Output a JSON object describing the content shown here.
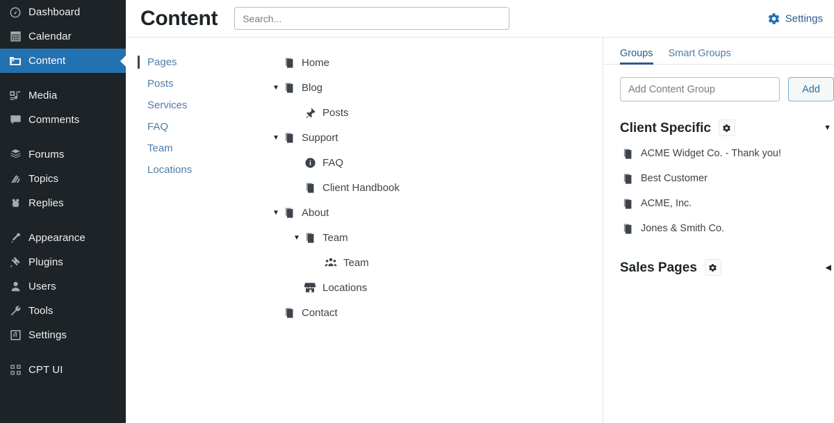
{
  "sidebar": {
    "items": [
      {
        "label": "Dashboard",
        "icon": "dashboard-icon",
        "active": false,
        "gap_after": false
      },
      {
        "label": "Calendar",
        "icon": "calendar-icon",
        "active": false,
        "gap_after": false
      },
      {
        "label": "Content",
        "icon": "folder-icon",
        "active": true,
        "gap_after": true
      },
      {
        "label": "Media",
        "icon": "media-icon",
        "active": false,
        "gap_after": false
      },
      {
        "label": "Comments",
        "icon": "comments-icon",
        "active": false,
        "gap_after": true
      },
      {
        "label": "Forums",
        "icon": "forums-icon",
        "active": false,
        "gap_after": false
      },
      {
        "label": "Topics",
        "icon": "topics-icon",
        "active": false,
        "gap_after": false
      },
      {
        "label": "Replies",
        "icon": "replies-icon",
        "active": false,
        "gap_after": true
      },
      {
        "label": "Appearance",
        "icon": "appearance-icon",
        "active": false,
        "gap_after": false
      },
      {
        "label": "Plugins",
        "icon": "plugins-icon",
        "active": false,
        "gap_after": false
      },
      {
        "label": "Users",
        "icon": "users-icon",
        "active": false,
        "gap_after": false
      },
      {
        "label": "Tools",
        "icon": "tools-icon",
        "active": false,
        "gap_after": false
      },
      {
        "label": "Settings",
        "icon": "settings-icon",
        "active": false,
        "gap_after": true
      },
      {
        "label": "CPT UI",
        "icon": "cptui-icon",
        "active": false,
        "gap_after": false
      }
    ],
    "accent_color": "#2271b1",
    "background_color": "#1d2327"
  },
  "header": {
    "title": "Content",
    "search_placeholder": "Search...",
    "search_value": "",
    "settings_label": "Settings",
    "settings_icon": "gear-icon"
  },
  "content_types": {
    "items": [
      {
        "label": "Pages",
        "selected": true
      },
      {
        "label": "Posts",
        "selected": false
      },
      {
        "label": "Services",
        "selected": false
      },
      {
        "label": "FAQ",
        "selected": false
      },
      {
        "label": "Team",
        "selected": false
      },
      {
        "label": "Locations",
        "selected": false
      }
    ]
  },
  "tree": {
    "nodes": [
      {
        "label": "Home",
        "icon": "pages-icon",
        "indent": 0,
        "caret": "none"
      },
      {
        "label": "Blog",
        "icon": "pages-icon",
        "indent": 0,
        "caret": "down"
      },
      {
        "label": "Posts",
        "icon": "pin-icon",
        "indent": 1,
        "caret": "none"
      },
      {
        "label": "Support",
        "icon": "pages-icon",
        "indent": 0,
        "caret": "down"
      },
      {
        "label": "FAQ",
        "icon": "info-icon",
        "indent": 1,
        "caret": "none"
      },
      {
        "label": "Client Handbook",
        "icon": "pages-icon",
        "indent": 1,
        "caret": "none"
      },
      {
        "label": "About",
        "icon": "pages-icon",
        "indent": 0,
        "caret": "down"
      },
      {
        "label": "Team",
        "icon": "pages-icon",
        "indent": 1,
        "caret": "down"
      },
      {
        "label": "Team",
        "icon": "group-icon",
        "indent": 2,
        "caret": "none"
      },
      {
        "label": "Locations",
        "icon": "storefront-icon",
        "indent": 1,
        "caret": "none"
      },
      {
        "label": "Contact",
        "icon": "pages-icon",
        "indent": 0,
        "caret": "none"
      }
    ]
  },
  "groups_panel": {
    "tabs": [
      {
        "label": "Groups",
        "active": true
      },
      {
        "label": "Smart Groups",
        "active": false
      }
    ],
    "add_input_placeholder": "Add Content Group",
    "add_input_value": "",
    "add_button_label": "Add",
    "groups": [
      {
        "name": "Client Specific",
        "gear_icon": "gear-icon",
        "toggle_icon": "chevron-down-icon",
        "expanded": true,
        "items": [
          {
            "label": "ACME Widget Co. - Thank you!",
            "icon": "pages-icon"
          },
          {
            "label": "Best Customer",
            "icon": "pages-icon"
          },
          {
            "label": "ACME, Inc.",
            "icon": "pages-icon"
          },
          {
            "label": "Jones & Smith Co.",
            "icon": "pages-icon"
          }
        ]
      },
      {
        "name": "Sales Pages",
        "gear_icon": "gear-icon",
        "toggle_icon": "chevron-left-icon",
        "expanded": false,
        "items": []
      }
    ]
  },
  "colors": {
    "accent": "#2271b1",
    "tab_active": "#2c5a8c",
    "link": "#4f7da8",
    "sidebar_bg": "#1d2327",
    "text": "#3c434a",
    "border": "#e2e4e7"
  }
}
